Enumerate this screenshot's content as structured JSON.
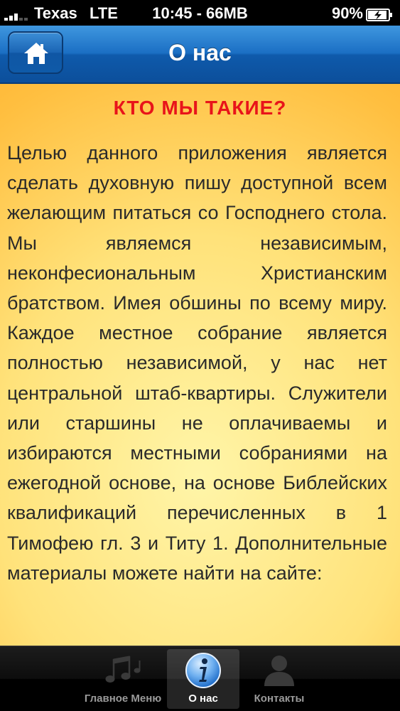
{
  "status_bar": {
    "carrier": "Texas",
    "network": "LTE",
    "time_memory": "10:45 - 66MB",
    "battery": "90%"
  },
  "nav": {
    "title": "О нас",
    "home_icon": "house-icon"
  },
  "content": {
    "heading": "КТО МЫ ТАКИЕ?",
    "body": "Целью данного приложения является сделать духовную пишу доступной всем желающим питаться со Господнего стола. Мы являемся независимым, неконфесиональным Христианским братством. Имея обшины по всему миру. Каждое местное собрание является полностью независимой, у нас нет центральной штаб-квартиры. Служители или старшины не оплачиваемы и избираются местными собраниями на ежегодной основе, на основе Библейских квалификаций перечисленных в 1 Тимофею гл. 3 и Титу 1. Дополнительные материалы можете найти на сайте:"
  },
  "tabs": [
    {
      "label": "Главное Меню",
      "icon": "music-notes-icon",
      "selected": false
    },
    {
      "label": "О нас",
      "icon": "info-icon",
      "selected": true
    },
    {
      "label": "Контакты",
      "icon": "person-icon",
      "selected": false
    }
  ],
  "colors": {
    "nav_blue": "#1b6fc4",
    "heading_red": "#e8141a",
    "content_yellow": "#ffe27a",
    "content_orange": "#ffb02b"
  }
}
